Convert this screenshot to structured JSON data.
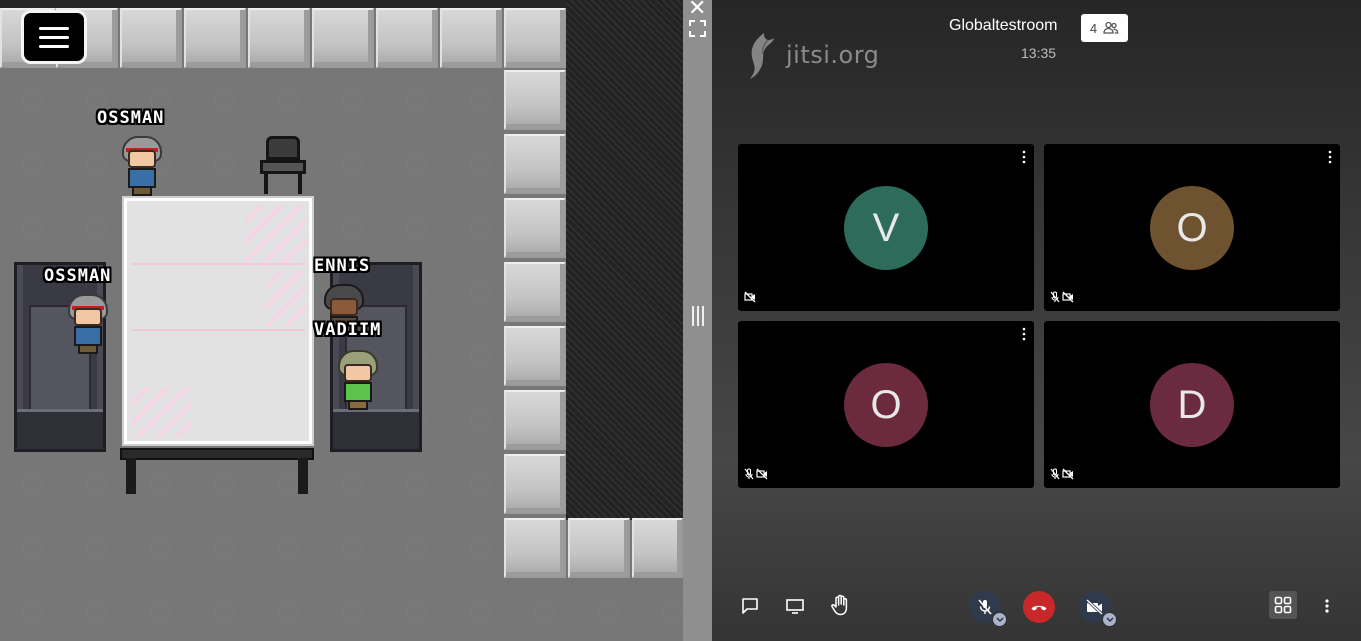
{
  "game": {
    "players": [
      {
        "name": "OSSMAN"
      },
      {
        "name": "OSSMAN"
      },
      {
        "name": "ENNIS"
      },
      {
        "name": "VADIIM"
      }
    ]
  },
  "conference": {
    "logo_text": "jitsi.org",
    "room_name": "Globaltestroom",
    "time": "13:35",
    "participant_count": "4",
    "tiles": [
      {
        "initial": "V",
        "color": "#2d6b5a",
        "mic_muted": false,
        "video_muted": true
      },
      {
        "initial": "O",
        "color": "#6f5331",
        "mic_muted": true,
        "video_muted": true
      },
      {
        "initial": "O",
        "color": "#6b2a3d",
        "mic_muted": true,
        "video_muted": true
      },
      {
        "initial": "D",
        "color": "#6a2a40",
        "mic_muted": true,
        "video_muted": true
      }
    ]
  },
  "colors": {
    "hangup": "#c8282a",
    "mic_button": "#2f3a4d",
    "camera_button": "#2f3a4d",
    "tile_view_active": "#545454"
  }
}
